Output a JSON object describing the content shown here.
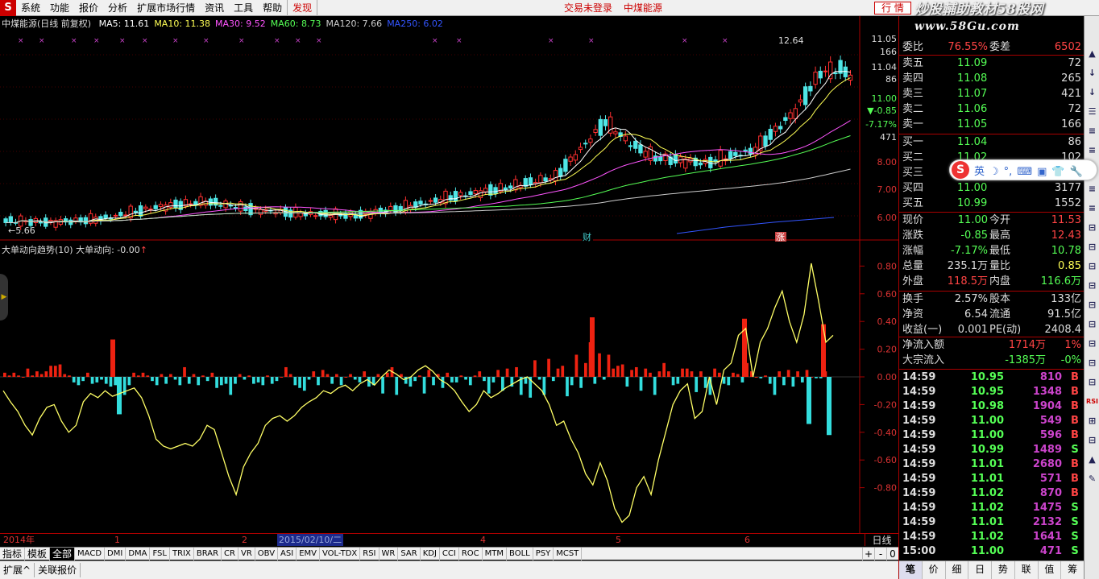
{
  "menu": {
    "logo": "S",
    "items": [
      "系统",
      "功能",
      "报价",
      "分析",
      "扩展市场行情",
      "资讯",
      "工具",
      "帮助"
    ],
    "discover": "发现",
    "center": [
      "交易未登录",
      "中煤能源"
    ],
    "quote_button": "行 情"
  },
  "watermark": {
    "line1": "炒股輔助教材58股网",
    "line2": "www.58Gu.com"
  },
  "main_info": {
    "title": "中煤能源(日线 前复权)",
    "ma": [
      {
        "label": "MA5: 11.61",
        "arrow": "↓",
        "color": "#ffffff"
      },
      {
        "label": "MA10: 11.38",
        "arrow": "↑",
        "color": "#ffff55"
      },
      {
        "label": "MA30: 9.52",
        "arrow": "↑",
        "color": "#ff55ff"
      },
      {
        "label": "MA60: 8.73",
        "arrow": "↑",
        "color": "#55ff55"
      },
      {
        "label": "MA120: 7.66",
        "arrow": "↑",
        "color": "#cccccc"
      },
      {
        "label": "MA250: 6.02",
        "arrow": "↑",
        "color": "#3355ff"
      }
    ]
  },
  "sub_info": {
    "title": "大单动向趋势(10)",
    "label": "大单动向: -0.00",
    "arrow": "↑"
  },
  "annotations": {
    "high": "12.64",
    "low": "5.66",
    "cai": "财",
    "zhang": "涨"
  },
  "axis": {
    "main_ticks": [
      {
        "v": "11.05",
        "c": "#ddd"
      },
      {
        "v": "166",
        "c": "#ddd"
      },
      {
        "v": "11.04",
        "c": "#ddd"
      },
      {
        "v": "86",
        "c": "#ddd"
      },
      {
        "v": "11.00",
        "c": "#5f5"
      },
      {
        "v": "▼-0.85",
        "c": "#5f5"
      },
      {
        "v": "-7.17%",
        "c": "#5f5"
      },
      {
        "v": "471",
        "c": "#ddd"
      },
      {
        "v": "8.00",
        "c": "#d33"
      },
      {
        "v": "7.00",
        "c": "#d33"
      },
      {
        "v": "6.00",
        "c": "#d33"
      }
    ],
    "sub_ticks": [
      "0.80",
      "0.60",
      "0.40",
      "0.20",
      "0.00",
      "-0.20",
      "-0.40",
      "-0.60",
      "-0.80"
    ]
  },
  "dates": {
    "labels": [
      "2014年",
      "1",
      "2",
      "4",
      "5",
      "6"
    ],
    "highlight": "2015/02/10/二",
    "period": "日线"
  },
  "indicator_tabs": [
    "指标",
    "模板",
    "全部",
    "MACD",
    "DMI",
    "DMA",
    "FSL",
    "TRIX",
    "BRAR",
    "CR",
    "VR",
    "OBV",
    "ASI",
    "EMV",
    "VOL-TDX",
    "RSI",
    "WR",
    "SAR",
    "KDJ",
    "CCI",
    "ROC",
    "MTM",
    "BOLL",
    "PSY",
    "MCST"
  ],
  "tab_controls": [
    "+",
    "-",
    "0"
  ],
  "bottom_bar": [
    "扩展^",
    "关联报价"
  ],
  "order_book": {
    "header": {
      "k": "委比",
      "v": "76.55%",
      "k2": "委差",
      "v2": "6502"
    },
    "sell": [
      {
        "label": "卖五",
        "price": "11.09",
        "vol": "72"
      },
      {
        "label": "卖四",
        "price": "11.08",
        "vol": "265"
      },
      {
        "label": "卖三",
        "price": "11.07",
        "vol": "421"
      },
      {
        "label": "卖二",
        "price": "11.06",
        "vol": "72"
      },
      {
        "label": "卖一",
        "price": "11.05",
        "vol": "166"
      }
    ],
    "buy": [
      {
        "label": "买一",
        "price": "11.04",
        "vol": "86"
      },
      {
        "label": "买二",
        "price": "11.02",
        "vol": "102"
      },
      {
        "label": "买三",
        "price": "",
        "vol": ""
      },
      {
        "label": "买四",
        "price": "11.00",
        "vol": "3177"
      },
      {
        "label": "买五",
        "price": "10.99",
        "vol": "1552"
      }
    ]
  },
  "stats": [
    {
      "k": "现价",
      "v": "11.00",
      "vc": "#5f5",
      "k2": "今开",
      "v2": "11.53",
      "v2c": "#f44"
    },
    {
      "k": "涨跌",
      "v": "-0.85",
      "vc": "#5f5",
      "k2": "最高",
      "v2": "12.43",
      "v2c": "#f44"
    },
    {
      "k": "涨幅",
      "v": "-7.17%",
      "vc": "#5f5",
      "k2": "最低",
      "v2": "10.78",
      "v2c": "#5f5"
    },
    {
      "k": "总量",
      "v": "235.1万",
      "vc": "#ddd",
      "k2": "量比",
      "v2": "0.85",
      "v2c": "#ff5"
    },
    {
      "k": "外盘",
      "v": "118.5万",
      "vc": "#f44",
      "k2": "内盘",
      "v2": "116.6万",
      "v2c": "#5f5"
    },
    {
      "k": "换手",
      "v": "2.57%",
      "vc": "#ddd",
      "k2": "股本",
      "v2": "133亿",
      "v2c": "#ddd"
    },
    {
      "k": "净资",
      "v": "6.54",
      "vc": "#ddd",
      "k2": "流通",
      "v2": "91.5亿",
      "v2c": "#ddd"
    },
    {
      "k": "收益(一)",
      "v": "0.001",
      "vc": "#ddd",
      "k2": "PE(动)",
      "v2": "2408.4",
      "v2c": "#ddd"
    }
  ],
  "flows": [
    {
      "k": "净流入额",
      "v": "1714万",
      "p": "1%",
      "c": "#f44"
    },
    {
      "k": "大宗流入",
      "v": "-1385万",
      "p": "-0%",
      "c": "#5f5"
    }
  ],
  "ticks": [
    {
      "t": "14:59",
      "p": "10.95",
      "q": "810",
      "s": "B"
    },
    {
      "t": "14:59",
      "p": "10.95",
      "q": "1348",
      "s": "B"
    },
    {
      "t": "14:59",
      "p": "10.98",
      "q": "1904",
      "s": "B"
    },
    {
      "t": "14:59",
      "p": "11.00",
      "q": "549",
      "s": "B"
    },
    {
      "t": "14:59",
      "p": "11.00",
      "q": "596",
      "s": "B"
    },
    {
      "t": "14:59",
      "p": "10.99",
      "q": "1489",
      "s": "S"
    },
    {
      "t": "14:59",
      "p": "11.01",
      "q": "2680",
      "s": "B"
    },
    {
      "t": "14:59",
      "p": "11.01",
      "q": "571",
      "s": "B"
    },
    {
      "t": "14:59",
      "p": "11.02",
      "q": "870",
      "s": "B"
    },
    {
      "t": "14:59",
      "p": "11.02",
      "q": "1475",
      "s": "S"
    },
    {
      "t": "14:59",
      "p": "11.01",
      "q": "2132",
      "s": "S"
    },
    {
      "t": "14:59",
      "p": "11.02",
      "q": "1641",
      "s": "S"
    },
    {
      "t": "15:00",
      "p": "11.00",
      "q": "471",
      "s": "S"
    }
  ],
  "right_tabs": [
    "笔",
    "价",
    "细",
    "日",
    "势",
    "联",
    "值",
    "筹"
  ],
  "ime": {
    "logo": "S",
    "items": [
      "英",
      "☽",
      "°,",
      "⌨",
      "▣",
      "👕",
      "🔧"
    ]
  },
  "toolbar_icons": [
    "▲",
    "↓",
    "↓",
    "☰",
    "≡",
    "≡",
    "⊞",
    "≡",
    "≡",
    "⊟",
    "⊟",
    "⊟",
    "⊟",
    "⊟",
    "⊟",
    "⊟",
    "⊟",
    "⊟",
    "RSI",
    "⊞",
    "⊟",
    "▲",
    "✎"
  ],
  "chart_data": [
    {
      "type": "candlestick",
      "title": "中煤能源(日线 前复权)",
      "ylim": [
        5.4,
        12.9
      ],
      "high_label": "12.64",
      "low_label": "5.66",
      "ma_lines": [
        "MA5",
        "MA10",
        "MA30",
        "MA60",
        "MA120",
        "MA250"
      ]
    },
    {
      "type": "bar+line",
      "title": "大单动向趋势(10)",
      "ylim": [
        -1.1,
        0.95
      ],
      "bars": [
        0.03,
        0.01,
        0.03,
        0.01,
        0.0,
        0.06,
        0.01,
        0.04,
        0.02,
        0.04,
        0.08,
        0.08,
        0.09,
        0.02,
        0.01,
        -0.04,
        -0.06,
        -0.03,
        0.03,
        -0.05,
        -0.04,
        -0.02,
        -0.05,
        -0.07,
        -0.06,
        -0.03,
        -0.13,
        -0.06,
        0.03,
        0.01,
        0.03,
        0.01,
        -0.03,
        -0.06,
        0.02,
        -0.05,
        0.02,
        -0.02,
        -0.06,
        0.07,
        -0.05,
        0.02,
        -0.06,
        0.01,
        -0.03,
        0.03,
        -0.08,
        -0.06,
        -0.05,
        -0.13,
        -0.05,
        0.02,
        -0.02,
        0.01,
        -0.05,
        -0.04,
        -0.06,
        0.01,
        -0.05,
        -0.03,
        0.0,
        0.07,
        0.02,
        -0.06,
        -0.08,
        -0.1,
        -0.02,
        0.04,
        -0.06,
        0.05,
        0.02,
        -0.05,
        0.02,
        -0.06,
        0.0,
        0.02,
        -0.02,
        -0.04,
        0.04,
        -0.07,
        -0.06,
        0.02,
        -0.12,
        0.03,
        0.07,
        -0.13,
        0.02,
        -0.05,
        -0.07,
        -0.03,
        0.01,
        -0.12,
        0.05,
        -0.06,
        0.02,
        -0.08,
        0.03,
        -0.04,
        -0.04,
        0.01,
        -0.02,
        -0.06,
        0.01,
        0.04,
        -0.03,
        -0.12,
        -0.04,
        0.05,
        -0.1,
        0.06,
        -0.07,
        0.07,
        -0.13,
        -0.05,
        -0.15,
        0.12,
        -0.02,
        -0.13,
        0.13,
        -0.03,
        0.06,
        0.08,
        -0.14,
        -0.06,
        0.16,
        -0.08,
        0.1,
        0.25,
        -0.05,
        0.17,
        -0.02,
        0.16,
        0.06,
        0.08,
        0.09,
        -0.07,
        0.05,
        0.07,
        -0.1,
        0.06,
        0.03,
        -0.13,
        0.04,
        0.1,
        0.04,
        -0.06,
        -0.05,
        0.06,
        0.06,
        0.04,
        -0.11,
        0.04,
        -0.08,
        -0.13,
        0.06,
        0.03,
        -0.05,
        -0.06,
        0.03,
        0.02,
        -0.04,
        0.1,
        0.04,
        0.0,
        -0.01,
        0.01,
        -0.05,
        -0.13,
        0.04,
        -0.06,
        0.05,
        -0.07,
        0.04,
        -0.04,
        0.05,
        0.0,
        -0.01,
        -0.01,
        0.04,
        -0.01
      ],
      "line": [
        -0.1,
        -0.18,
        -0.25,
        -0.35,
        -0.42,
        -0.3,
        -0.22,
        -0.2,
        -0.32,
        -0.4,
        -0.35,
        -0.18,
        -0.12,
        -0.15,
        -0.1,
        -0.14,
        -0.12,
        -0.1,
        -0.08,
        -0.15,
        -0.28,
        -0.45,
        -0.5,
        -0.52,
        -0.5,
        -0.48,
        -0.5,
        -0.45,
        -0.35,
        -0.38,
        -0.55,
        -0.72,
        -0.85,
        -0.65,
        -0.55,
        -0.48,
        -0.35,
        -0.3,
        -0.28,
        -0.32,
        -0.28,
        -0.22,
        -0.18,
        -0.15,
        -0.1,
        -0.12,
        -0.08,
        -0.06,
        -0.1,
        -0.05,
        -0.02,
        -0.06,
        0.0,
        0.05,
        0.02,
        -0.02,
        0.0,
        0.05,
        0.08,
        0.04,
        -0.02,
        -0.05,
        -0.1,
        -0.18,
        -0.25,
        -0.2,
        -0.1,
        -0.15,
        -0.12,
        -0.08,
        -0.05,
        -0.02,
        0.0,
        -0.05,
        -0.1,
        -0.2,
        -0.35,
        -0.32,
        -0.45,
        -0.55,
        -0.7,
        -0.78,
        -0.62,
        -0.75,
        -0.95,
        -1.05,
        -1.0,
        -0.8,
        -0.72,
        -0.85,
        -0.6,
        -0.4,
        -0.2,
        -0.1,
        -0.05,
        -0.3,
        -0.25,
        0.0,
        -0.2,
        0.05,
        0.1,
        0.3,
        0.35,
        0.0,
        0.25,
        0.35,
        0.5,
        0.62,
        0.4,
        0.25,
        0.45,
        0.82,
        0.55,
        0.25,
        0.3
      ]
    }
  ]
}
